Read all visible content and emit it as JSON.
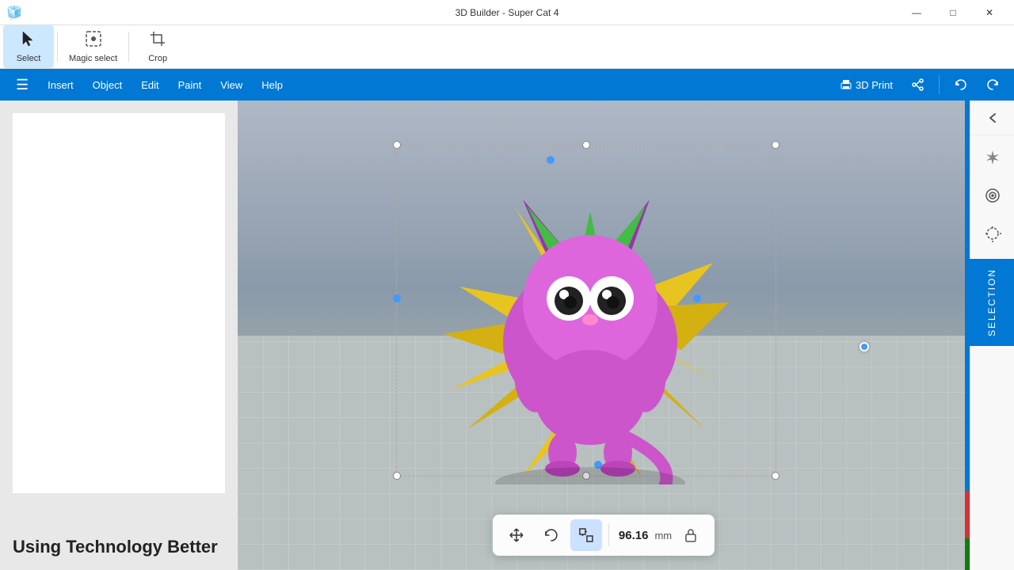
{
  "title_bar": {
    "title": "3D Builder - Super Cat 4",
    "minimize": "—",
    "maximize": "□",
    "close": "✕"
  },
  "toolbar": {
    "select_label": "Select",
    "magic_select_label": "Magic select",
    "crop_label": "Crop"
  },
  "menu": {
    "hamburger": "☰",
    "items": [
      "Insert",
      "Object",
      "Edit",
      "Paint",
      "View",
      "Help"
    ],
    "print_label": "3D Print",
    "undo_label": "↩",
    "redo_label": "↪"
  },
  "left_panel_text": "Using Technology Better",
  "float_toolbar": {
    "move_icon": "⤢",
    "rotate_icon": "↻",
    "scale_icon": "⊞",
    "value": "96.16",
    "unit": "mm",
    "lock_icon": "🔒"
  },
  "right_tools": [
    {
      "name": "back-icon",
      "icon": "‹",
      "label": "Back"
    },
    {
      "name": "sparkle-icon",
      "icon": "✦",
      "label": "Sparkle"
    },
    {
      "name": "effects-icon",
      "icon": "❋",
      "label": "Effects"
    },
    {
      "name": "lasso-icon",
      "icon": "⊕",
      "label": "Lasso"
    },
    {
      "name": "circle-icon",
      "icon": "○",
      "label": "Circle"
    },
    {
      "name": "selection-icon",
      "icon": "◎",
      "label": "Selection",
      "active": true
    }
  ],
  "selection_panel": {
    "text": "Selection"
  },
  "colors": {
    "primary_blue": "#0078d4",
    "toolbar_bg": "#ffffff",
    "menu_bg": "#0078d4",
    "viewport_bg": "#9aaabb",
    "accent_blue": "#4499ff"
  }
}
